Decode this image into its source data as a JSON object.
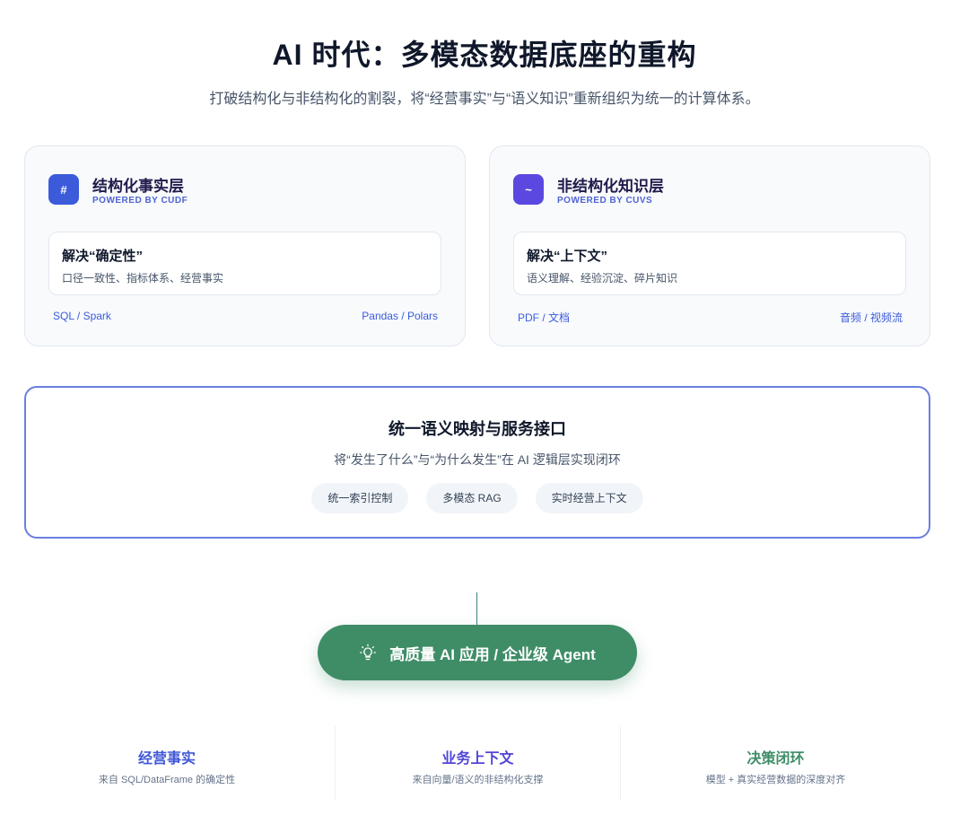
{
  "header": {
    "title": "AI 时代：多模态数据底座的重构",
    "subtitle": "打破结构化与非结构化的割裂，将“经营事实”与“语义知识”重新组织为统一的计算体系。"
  },
  "cards": [
    {
      "icon_glyph": "#",
      "icon_name": "hash-icon",
      "title": "结构化事实层",
      "powered": "POWERED BY CUDF",
      "inner_title": "解决“确定性”",
      "inner_desc": "口径一致性、指标体系、经营事实",
      "tag_left": "SQL / Spark",
      "tag_right": "Pandas / Polars"
    },
    {
      "icon_glyph": "~",
      "icon_name": "tilde-icon",
      "title": "非结构化知识层",
      "powered": "POWERED BY CUVS",
      "inner_title": "解决“上下文”",
      "inner_desc": "语义理解、经验沉淀、碎片知识",
      "tag_left": "PDF / 文档",
      "tag_right": "音频 / 视频流"
    }
  ],
  "mapping": {
    "title": "统一语义映射与服务接口",
    "subtitle": "将“发生了什么”与“为什么发生”在 AI 逻辑层实现闭环",
    "pills": [
      "统一索引控制",
      "多模态 RAG",
      "实时经营上下文"
    ]
  },
  "agent": {
    "label": "高质量 AI 应用 / 企业级 Agent",
    "icon_name": "lightbulb-icon"
  },
  "stats": [
    {
      "title": "经营事实",
      "desc": "来自 SQL/DataFrame 的确定性"
    },
    {
      "title": "业务上下文",
      "desc": "来自向量/语义的非结构化支撑"
    },
    {
      "title": "决策闭环",
      "desc": "模型 + 真实经营数据的深度对齐"
    }
  ],
  "colors": {
    "accent_blue": "#3b5bdb",
    "accent_purple": "#5b48e0",
    "agent_green": "#3f8d67",
    "mapping_border": "#6b7fe0"
  }
}
